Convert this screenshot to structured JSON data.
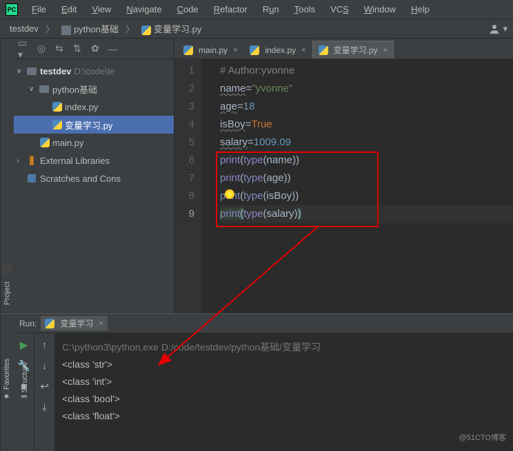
{
  "menubar": [
    "File",
    "Edit",
    "View",
    "Navigate",
    "Code",
    "Refactor",
    "Run",
    "Tools",
    "VCS",
    "Window",
    "Help"
  ],
  "breadcrumb": {
    "root": "testdev",
    "folder": "python基础",
    "file": "变量学习.py"
  },
  "project": {
    "strip_label": "Project",
    "root": {
      "name": "testdev",
      "path": "D:\\code\\te"
    },
    "folder": "python基础",
    "files": [
      "index.py",
      "变量学习.py"
    ],
    "root_file": "main.py",
    "ext_lib": "External Libraries",
    "scratch": "Scratches and Cons"
  },
  "tabs": [
    {
      "label": "main.py",
      "active": false
    },
    {
      "label": "index.py",
      "active": false
    },
    {
      "label": "变量学习.py",
      "active": true
    }
  ],
  "code": {
    "line_numbers": [
      1,
      2,
      3,
      4,
      5,
      6,
      7,
      8,
      9
    ],
    "l1_comment": "# Author:yvonne",
    "l2_var": "name",
    "l2_val": "\"yvonne\"",
    "l3_var": "age",
    "l3_val": "18",
    "l4_var": "isBoy",
    "l4_val": "True",
    "l5_var": "salary",
    "l5_val": "1009.09",
    "print": "print",
    "type": "type",
    "p6": "name",
    "p7": "age",
    "p8": "isBoy",
    "p9": "salary",
    "eq": "="
  },
  "structure_label": "Structure",
  "favorites_label": "Favorites",
  "run": {
    "label": "Run:",
    "tab": "变量学习",
    "cmd": "C:\\python3\\python.exe D:/code/testdev/python基础/变量学习",
    "out": [
      "<class 'str'>",
      "<class 'int'>",
      "<class 'bool'>",
      "<class 'float'>"
    ]
  },
  "watermark": "@51CTO博客"
}
